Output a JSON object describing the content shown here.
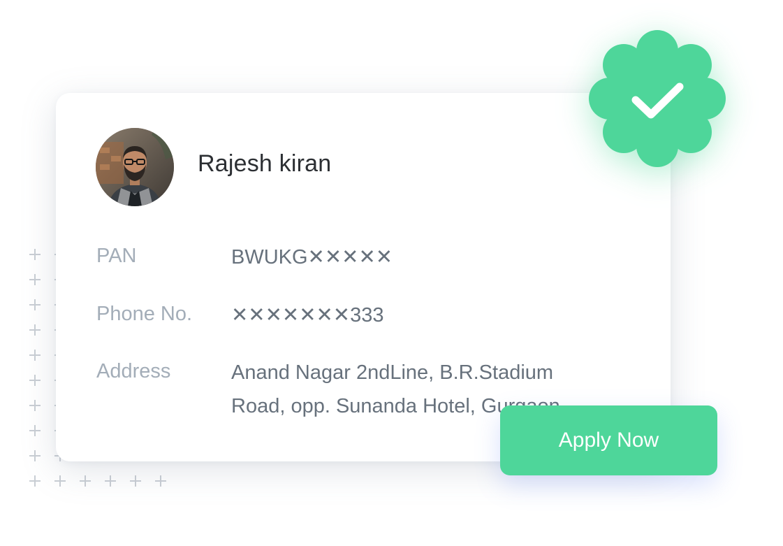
{
  "user": {
    "name": "Rajesh kiran",
    "avatar_icon": "user-avatar-photo"
  },
  "details": {
    "pan": {
      "label": "PAN",
      "value": "BWUKG✕✕✕✕✕"
    },
    "phone": {
      "label": "Phone No.",
      "value": "✕✕✕✕✕✕✕333"
    },
    "address": {
      "label": "Address",
      "line1": "Anand Nagar 2ndLine, B.R.Stadium",
      "line2": "Road, opp. Sunanda Hotel, Gurgaon"
    }
  },
  "verified_badge": {
    "icon": "verified-check-icon",
    "color": "#4ed69a"
  },
  "actions": {
    "apply_label": "Apply Now"
  },
  "colors": {
    "accent": "#4ed69a",
    "name_text": "#2c2f33",
    "label_text": "#a3adb8",
    "value_text": "#67717c"
  }
}
